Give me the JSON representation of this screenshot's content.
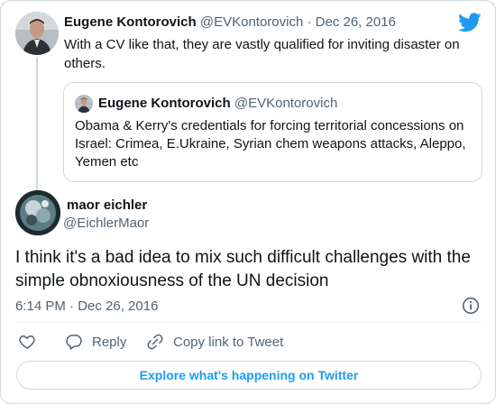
{
  "colors": {
    "twitter_blue": "#1d9bf0",
    "text_primary": "#0f1419",
    "text_secondary": "#536471",
    "border": "#cfd9de"
  },
  "parent_tweet": {
    "name": "Eugene Kontorovich",
    "handle": "@EVKontorovich",
    "separator": "·",
    "date": "Dec 26, 2016",
    "text": "With a CV like that, they are vastly qualified for inviting disaster on others.",
    "avatar_icon": "profile-photo",
    "logo_icon": "twitter-bird-icon"
  },
  "quoted_tweet": {
    "name": "Eugene Kontorovich",
    "handle": "@EVKontorovich",
    "text": "Obama & Kerry's credentials for forcing territorial concessions on Israel: Crimea, E.Ukraine, Syrian chem weapons attacks, Aleppo, Yemen etc"
  },
  "main_tweet": {
    "name": "maor eichler",
    "handle": "@EichlerMaor",
    "text": "I think it's a bad idea to mix such difficult challenges with the simple obnoxiousness of the UN decision",
    "timestamp": "6:14 PM · Dec 26, 2016"
  },
  "actions": {
    "like_icon": "heart-icon",
    "reply_label": "Reply",
    "copy_label": "Copy link to Tweet"
  },
  "footer": {
    "explore_label": "Explore what's happening on Twitter"
  }
}
